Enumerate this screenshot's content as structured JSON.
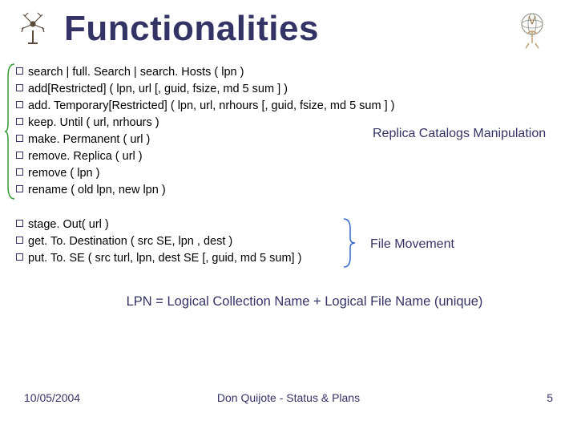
{
  "title": "Functionalities",
  "group1": {
    "items": [
      "search | full. Search | search. Hosts ( lpn )",
      "add[Restricted] ( lpn, url [, guid, fsize, md 5 sum ] )",
      "add. Temporary[Restricted] ( lpn, url, nrhours [, guid, fsize, md 5 sum ] )",
      "keep. Until ( url, nrhours )",
      "make. Permanent ( url )",
      "remove. Replica ( url )",
      "remove ( lpn )",
      "rename ( old lpn, new lpn )"
    ],
    "annotation": "Replica Catalogs Manipulation"
  },
  "group2": {
    "items": [
      "stage. Out( url )",
      "get. To. Destination ( src SE, lpn , dest )",
      "put. To. SE ( src turl, lpn, dest SE [, guid, md 5 sum] )"
    ],
    "annotation": "File Movement"
  },
  "note": "LPN = Logical Collection Name + Logical File Name (unique)",
  "footer": {
    "date": "10/05/2004",
    "center": "Don Quijote - Status & Plans",
    "page": "5"
  }
}
